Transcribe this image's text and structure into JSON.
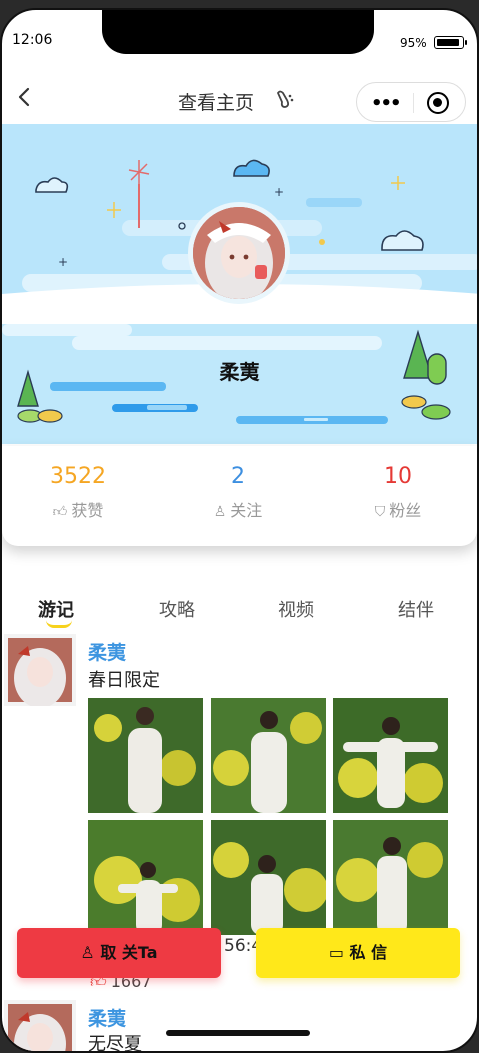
{
  "status_bar": {
    "time": "12:06",
    "battery_percent": "95%",
    "battery_level": 0.95
  },
  "nav": {
    "title": "查看主页",
    "icons": [
      "back-icon",
      "footprint-icon",
      "more-icon",
      "close-target-icon"
    ]
  },
  "profile": {
    "name": "柔荑"
  },
  "stats": [
    {
      "value": "3522",
      "label": "获赞",
      "color": "#f5a623",
      "icon": "thumb-up-icon"
    },
    {
      "value": "2",
      "label": "关注",
      "color": "#3d8fe0",
      "icon": "user-icon"
    },
    {
      "value": "10",
      "label": "粉丝",
      "color": "#e53935",
      "icon": "shield-icon"
    }
  ],
  "tabs": [
    {
      "label": "游记",
      "active": true
    },
    {
      "label": "攻略",
      "active": false
    },
    {
      "label": "视频",
      "active": false
    },
    {
      "label": "结伴",
      "active": false
    }
  ],
  "posts": [
    {
      "author": "柔荑",
      "text": "春日限定",
      "time_fragment": "56:4",
      "likes": "1667"
    },
    {
      "author": "柔荑",
      "text": "无尽夏"
    }
  ],
  "actions": {
    "follow": "取 关Ta",
    "message": "私 信"
  },
  "colors": {
    "banner": "#b9e5fb",
    "name_blue": "#3d95e0",
    "follow_red": "#ee3a43",
    "message_yellow": "#ffe81a"
  }
}
